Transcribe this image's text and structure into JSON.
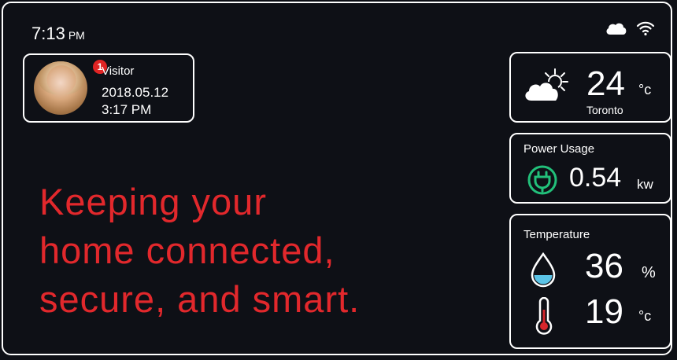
{
  "status_bar": {
    "time": "7:13",
    "ampm": "PM",
    "icons": [
      "cloud-icon",
      "wifi-icon"
    ]
  },
  "visitor": {
    "label": "Visitor",
    "badge_count": "1",
    "date": "2018.05.12",
    "time": "3:17 PM"
  },
  "tagline": {
    "line1": "Keeping your",
    "line2": "home connected,",
    "line3": "secure, and smart."
  },
  "weather": {
    "temperature": "24",
    "unit": "°c",
    "city": "Toronto",
    "icon": "partly-cloudy-icon"
  },
  "power": {
    "title": "Power Usage",
    "value": "0.54",
    "unit": "kw",
    "icon": "plug-icon"
  },
  "temperature": {
    "title": "Temperature",
    "humidity_value": "36",
    "humidity_unit": "%",
    "temp_value": "19",
    "temp_unit": "°c"
  },
  "colors": {
    "background": "#0e1016",
    "accent_red": "#e2282c",
    "badge_red": "#e02424",
    "power_green": "#22c07a",
    "water_blue": "#5bc3e6",
    "thermo_red": "#d6262c"
  }
}
